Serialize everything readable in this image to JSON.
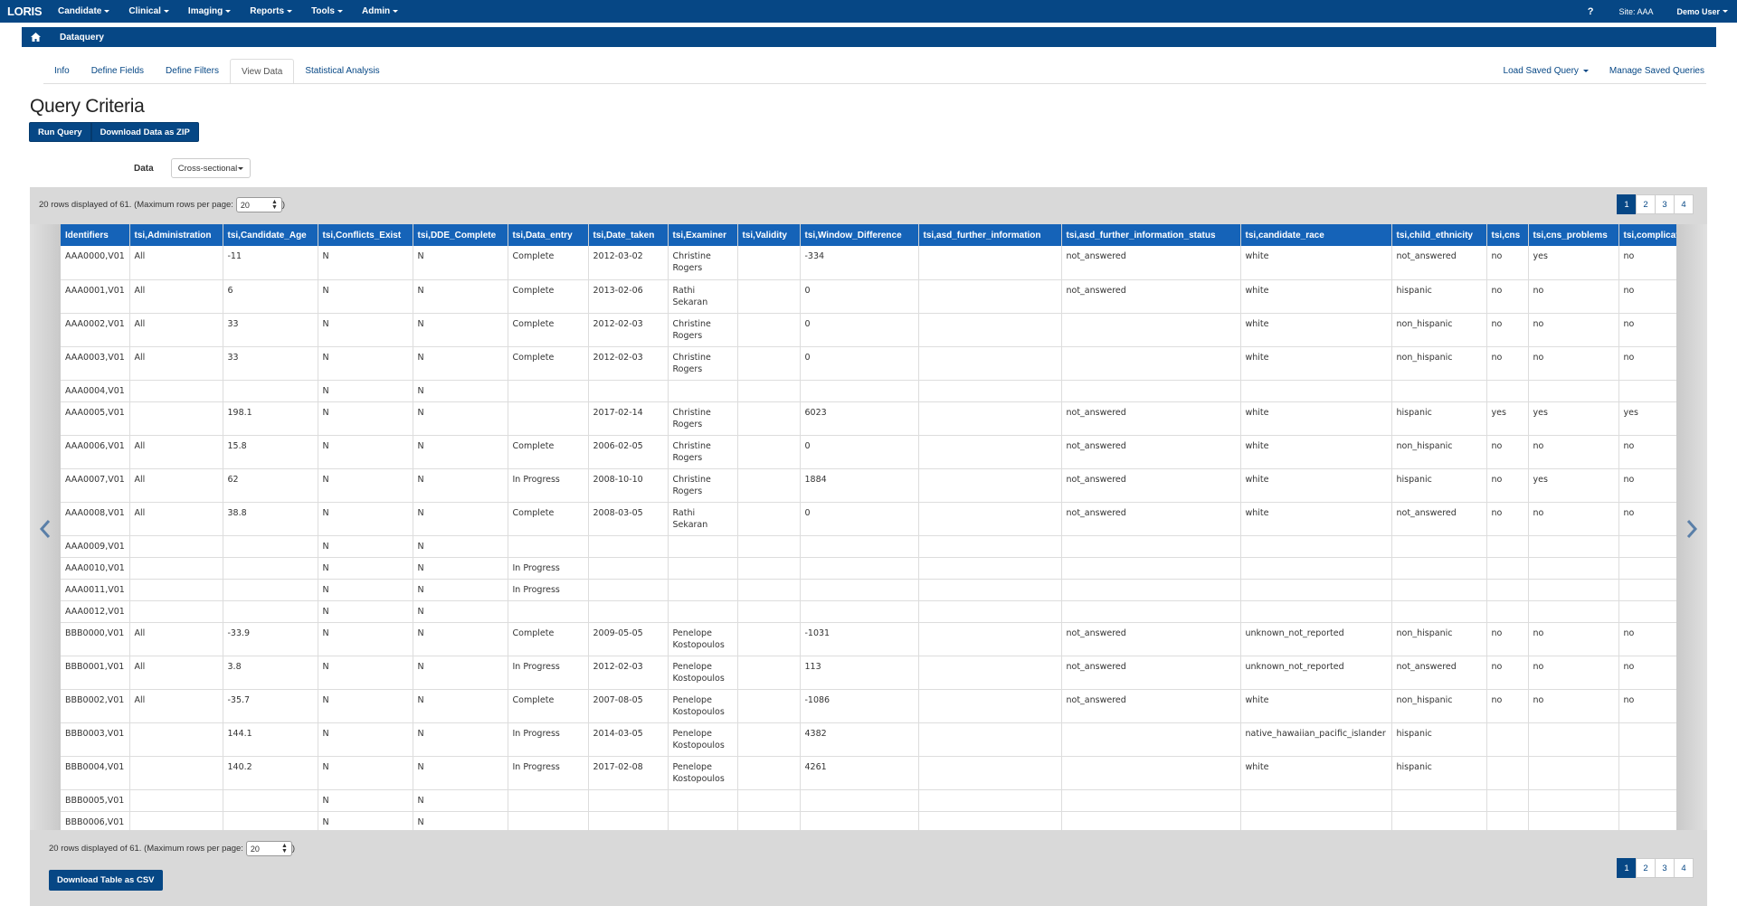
{
  "navbar": {
    "brand": "LORIS",
    "menus": [
      "Candidate",
      "Clinical",
      "Imaging",
      "Reports",
      "Tools",
      "Admin"
    ],
    "help": "?",
    "site": "Site: AAA",
    "user": "Demo User"
  },
  "breadcrumb": {
    "current": "Dataquery"
  },
  "tabs": {
    "items": [
      "Info",
      "Define Fields",
      "Define Filters",
      "View Data",
      "Statistical Analysis"
    ],
    "active": "View Data",
    "load_saved": "Load Saved Query",
    "manage_saved": "Manage Saved Queries"
  },
  "page": {
    "title": "Query Criteria",
    "run_button": "Run Query",
    "download_zip_button": "Download Data as ZIP",
    "data_label": "Data",
    "data_select": "Cross-sectional"
  },
  "results": {
    "info_prefix": "20 rows displayed of 61. (Maximum rows per page:",
    "info_suffix": ")",
    "rows_per_page": "20",
    "pages": [
      "1",
      "2",
      "3",
      "4"
    ],
    "active_page": "1",
    "csv_button": "Download Table as CSV"
  },
  "table": {
    "headers": [
      "Identifiers",
      "tsi,Administration",
      "tsi,Candidate_Age",
      "tsi,Conflicts_Exist",
      "tsi,DDE_Complete",
      "tsi,Data_entry",
      "tsi,Date_taken",
      "tsi,Examiner",
      "tsi,Validity",
      "tsi,Window_Difference",
      "tsi,asd_further_information",
      "tsi,asd_further_information_status",
      "tsi,candidate_race",
      "tsi,child_ethnicity",
      "tsi,cns",
      "tsi,cns_problems",
      "tsi,complications"
    ],
    "rows": [
      [
        "AAA0000,V01",
        "All",
        "-11",
        "N",
        "N",
        "Complete",
        "2012-03-02",
        "Christine Rogers",
        "",
        "-334",
        "",
        "not_answered",
        "white",
        "not_answered",
        "no",
        "yes",
        "no"
      ],
      [
        "AAA0001,V01",
        "All",
        "6",
        "N",
        "N",
        "Complete",
        "2013-02-06",
        "Rathi Sekaran",
        "",
        "0",
        "",
        "not_answered",
        "white",
        "hispanic",
        "no",
        "no",
        "no"
      ],
      [
        "AAA0002,V01",
        "All",
        "33",
        "N",
        "N",
        "Complete",
        "2012-02-03",
        "Christine Rogers",
        "",
        "0",
        "",
        "",
        "white",
        "non_hispanic",
        "no",
        "no",
        "no"
      ],
      [
        "AAA0003,V01",
        "All",
        "33",
        "N",
        "N",
        "Complete",
        "2012-02-03",
        "Christine Rogers",
        "",
        "0",
        "",
        "",
        "white",
        "non_hispanic",
        "no",
        "no",
        "no"
      ],
      [
        "AAA0004,V01",
        "",
        "",
        "N",
        "N",
        "",
        "",
        "",
        "",
        "",
        "",
        "",
        "",
        "",
        "",
        "",
        ""
      ],
      [
        "AAA0005,V01",
        "",
        "198.1",
        "N",
        "N",
        "",
        "2017-02-14",
        "Christine Rogers",
        "",
        "6023",
        "",
        "not_answered",
        "white",
        "hispanic",
        "yes",
        "yes",
        "yes"
      ],
      [
        "AAA0006,V01",
        "All",
        "15.8",
        "N",
        "N",
        "Complete",
        "2006-02-05",
        "Christine Rogers",
        "",
        "0",
        "",
        "not_answered",
        "white",
        "non_hispanic",
        "no",
        "no",
        "no"
      ],
      [
        "AAA0007,V01",
        "All",
        "62",
        "N",
        "N",
        "In Progress",
        "2008-10-10",
        "Christine Rogers",
        "",
        "1884",
        "",
        "not_answered",
        "white",
        "hispanic",
        "no",
        "yes",
        "no"
      ],
      [
        "AAA0008,V01",
        "All",
        "38.8",
        "N",
        "N",
        "Complete",
        "2008-03-05",
        "Rathi Sekaran",
        "",
        "0",
        "",
        "not_answered",
        "white",
        "not_answered",
        "no",
        "no",
        "no"
      ],
      [
        "AAA0009,V01",
        "",
        "",
        "N",
        "N",
        "",
        "",
        "",
        "",
        "",
        "",
        "",
        "",
        "",
        "",
        "",
        ""
      ],
      [
        "AAA0010,V01",
        "",
        "",
        "N",
        "N",
        "In Progress",
        "",
        "",
        "",
        "",
        "",
        "",
        "",
        "",
        "",
        "",
        ""
      ],
      [
        "AAA0011,V01",
        "",
        "",
        "N",
        "N",
        "In Progress",
        "",
        "",
        "",
        "",
        "",
        "",
        "",
        "",
        "",
        "",
        ""
      ],
      [
        "AAA0012,V01",
        "",
        "",
        "N",
        "N",
        "",
        "",
        "",
        "",
        "",
        "",
        "",
        "",
        "",
        "",
        "",
        ""
      ],
      [
        "BBB0000,V01",
        "All",
        "-33.9",
        "N",
        "N",
        "Complete",
        "2009-05-05",
        "Penelope Kostopoulos",
        "",
        "-1031",
        "",
        "not_answered",
        "unknown_not_reported",
        "non_hispanic",
        "no",
        "no",
        "no"
      ],
      [
        "BBB0001,V01",
        "All",
        "3.8",
        "N",
        "N",
        "In Progress",
        "2012-02-03",
        "Penelope Kostopoulos",
        "",
        "113",
        "",
        "not_answered",
        "unknown_not_reported",
        "not_answered",
        "no",
        "no",
        "no"
      ],
      [
        "BBB0002,V01",
        "All",
        "-35.7",
        "N",
        "N",
        "Complete",
        "2007-08-05",
        "Penelope Kostopoulos",
        "",
        "-1086",
        "",
        "not_answered",
        "white",
        "non_hispanic",
        "no",
        "no",
        "no"
      ],
      [
        "BBB0003,V01",
        "",
        "144.1",
        "N",
        "N",
        "In Progress",
        "2014-03-05",
        "Penelope Kostopoulos",
        "",
        "4382",
        "",
        "",
        "native_hawaiian_pacific_islander",
        "hispanic",
        "",
        "",
        ""
      ],
      [
        "BBB0004,V01",
        "",
        "140.2",
        "N",
        "N",
        "In Progress",
        "2017-02-08",
        "Penelope Kostopoulos",
        "",
        "4261",
        "",
        "",
        "white",
        "hispanic",
        "",
        "",
        ""
      ],
      [
        "BBB0005,V01",
        "",
        "",
        "N",
        "N",
        "",
        "",
        "",
        "",
        "",
        "",
        "",
        "",
        "",
        "",
        "",
        ""
      ],
      [
        "BBB0006,V01",
        "",
        "",
        "N",
        "N",
        "",
        "",
        "",
        "",
        "",
        "",
        "",
        "",
        "",
        "",
        "",
        ""
      ]
    ]
  },
  "colors": {
    "primary": "#064785",
    "header": "#1563b8",
    "panel": "#d9d9d9"
  }
}
